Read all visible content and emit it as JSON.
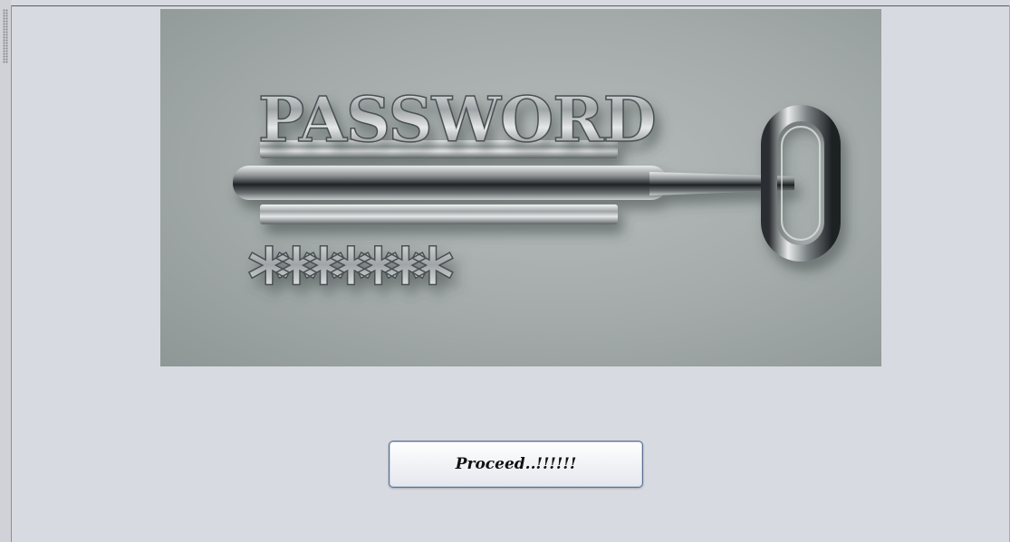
{
  "image": {
    "word": "PASSWORD",
    "mask": "*******"
  },
  "button": {
    "label": "Proceed..!!!!!!"
  },
  "colors": {
    "background": "#d8dae1",
    "image_background": "#a3aaa9",
    "metal": "#c9cccd",
    "button_border": "#5b6f8e"
  }
}
